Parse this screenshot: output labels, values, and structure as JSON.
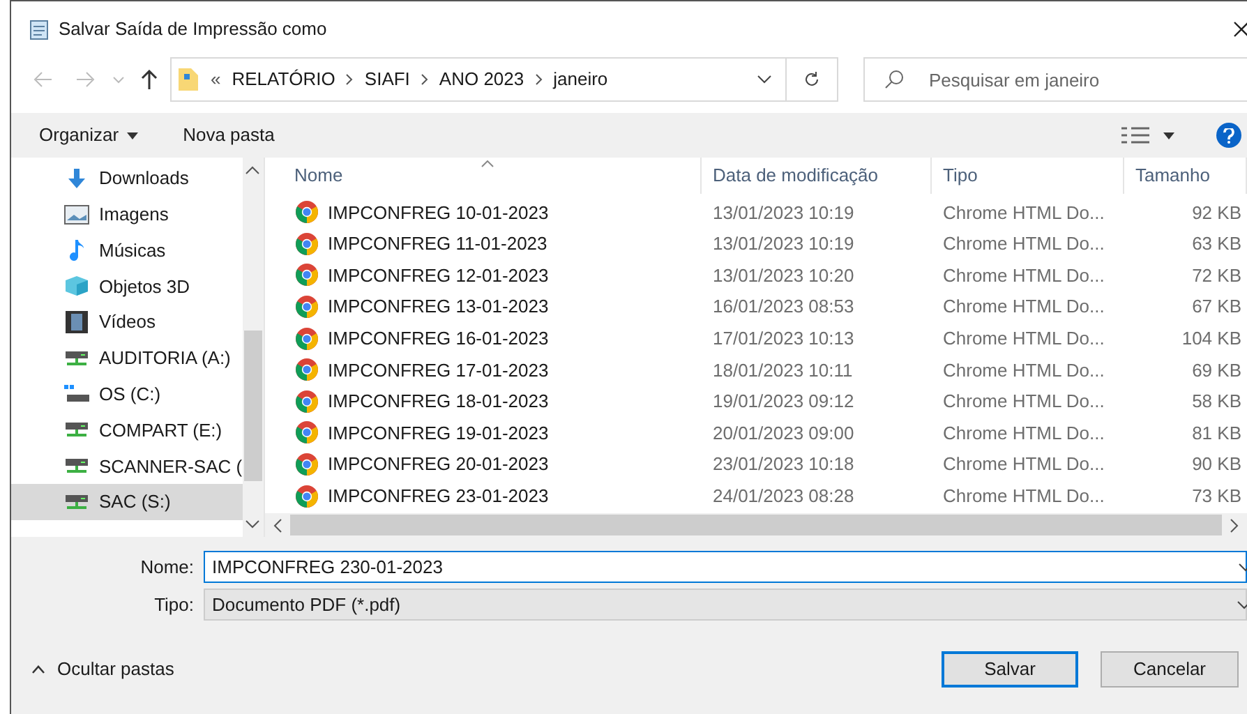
{
  "window": {
    "title": "Salvar Saída de Impressão como"
  },
  "address": {
    "overflow": "«",
    "crumbs": [
      "RELATÓRIO",
      "SIAFI",
      "ANO 2023",
      "janeiro"
    ]
  },
  "search": {
    "placeholder": "Pesquisar em janeiro"
  },
  "toolbar": {
    "organize": "Organizar",
    "new_folder": "Nova pasta"
  },
  "sidebar": {
    "items": [
      {
        "label": "Downloads",
        "kind": "downloads",
        "selected": false
      },
      {
        "label": "Imagens",
        "kind": "pictures",
        "selected": false
      },
      {
        "label": "Músicas",
        "kind": "music",
        "selected": false
      },
      {
        "label": "Objetos 3D",
        "kind": "objects",
        "selected": false
      },
      {
        "label": "Vídeos",
        "kind": "videos",
        "selected": false
      },
      {
        "label": "AUDITORIA (A:)",
        "kind": "netdrive",
        "selected": false
      },
      {
        "label": "OS (C:)",
        "kind": "osdrive",
        "selected": false
      },
      {
        "label": "COMPART (E:)",
        "kind": "netdrive",
        "selected": false
      },
      {
        "label": "SCANNER-SAC (",
        "kind": "netdrive",
        "selected": false
      },
      {
        "label": "SAC (S:)",
        "kind": "netdrive",
        "selected": true
      }
    ]
  },
  "table": {
    "columns": [
      "Nome",
      "Data de modificação",
      "Tipo",
      "Tamanho"
    ],
    "rows": [
      [
        "IMPCONFREG 10-01-2023",
        "13/01/2023 10:19",
        "Chrome HTML Do...",
        "92 KB"
      ],
      [
        "IMPCONFREG 11-01-2023",
        "13/01/2023 10:19",
        "Chrome HTML Do...",
        "63 KB"
      ],
      [
        "IMPCONFREG 12-01-2023",
        "13/01/2023 10:20",
        "Chrome HTML Do...",
        "72 KB"
      ],
      [
        "IMPCONFREG 13-01-2023",
        "16/01/2023 08:53",
        "Chrome HTML Do...",
        "67 KB"
      ],
      [
        "IMPCONFREG 16-01-2023",
        "17/01/2023 10:13",
        "Chrome HTML Do...",
        "104 KB"
      ],
      [
        "IMPCONFREG 17-01-2023",
        "18/01/2023 10:11",
        "Chrome HTML Do...",
        "69 KB"
      ],
      [
        "IMPCONFREG 18-01-2023",
        "19/01/2023 09:12",
        "Chrome HTML Do...",
        "58 KB"
      ],
      [
        "IMPCONFREG 19-01-2023",
        "20/01/2023 09:00",
        "Chrome HTML Do...",
        "81 KB"
      ],
      [
        "IMPCONFREG 20-01-2023",
        "23/01/2023 10:18",
        "Chrome HTML Do...",
        "90 KB"
      ],
      [
        "IMPCONFREG 23-01-2023",
        "24/01/2023 08:28",
        "Chrome HTML Do...",
        "73 KB"
      ]
    ]
  },
  "form": {
    "name_label": "Nome:",
    "name_value": "IMPCONFREG 230-01-2023",
    "type_label": "Tipo:",
    "type_value": "Documento PDF (*.pdf)"
  },
  "footer": {
    "hide_folders": "Ocultar pastas",
    "save": "Salvar",
    "cancel": "Cancelar"
  }
}
